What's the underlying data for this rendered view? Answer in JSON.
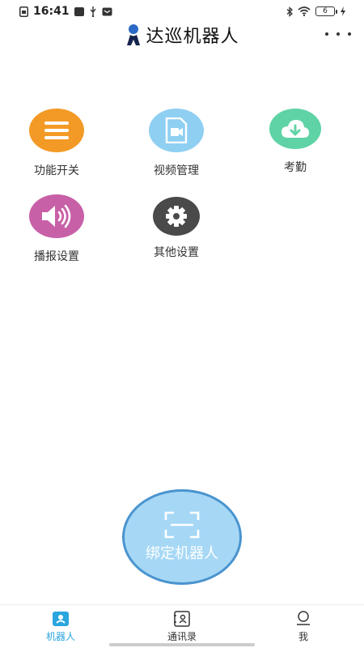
{
  "status_bar": {
    "time": "16:41",
    "battery": "6"
  },
  "header": {
    "title": "达巡机器人"
  },
  "menu": [
    {
      "label": "功能开关",
      "icon": "menu-lines-icon",
      "color": "#f39a26"
    },
    {
      "label": "视频管理",
      "icon": "video-file-icon",
      "color": "#8fcff2"
    },
    {
      "label": "考勤",
      "icon": "cloud-download-icon",
      "color": "#5fd3a5"
    },
    {
      "label": "播报设置",
      "icon": "speaker-icon",
      "color": "#c860a8"
    },
    {
      "label": "其他设置",
      "icon": "gear-icon",
      "color": "#4a4a4a"
    }
  ],
  "bind_button": {
    "label": "绑定机器人",
    "icon": "scan-frame-icon"
  },
  "bottom_nav": {
    "items": [
      {
        "label": "机器人",
        "icon": "robot-card-icon",
        "active": true
      },
      {
        "label": "通讯录",
        "icon": "contacts-icon",
        "active": false
      },
      {
        "label": "我",
        "icon": "user-icon",
        "active": false
      }
    ]
  },
  "colors": {
    "accent": "#2aa5dd",
    "bind_fill": "#a6d8f6",
    "bind_border": "#4a94cf"
  }
}
